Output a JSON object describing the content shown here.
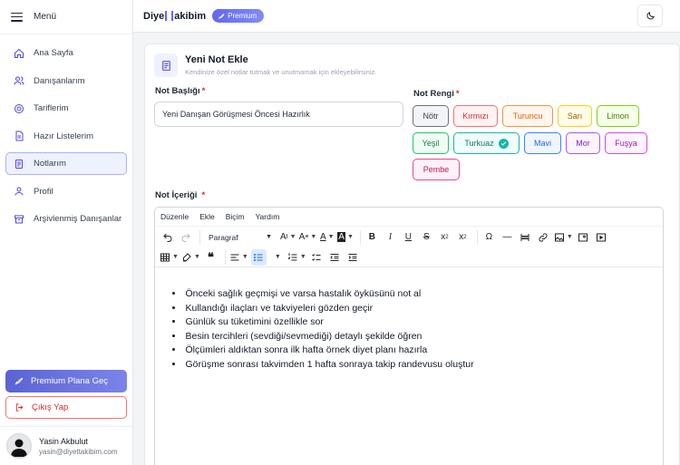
{
  "sidebar": {
    "title": "Menü",
    "items": [
      {
        "label": "Ana Sayfa",
        "icon": "home-icon"
      },
      {
        "label": "Danışanlarım",
        "icon": "users-icon"
      },
      {
        "label": "Tariflerim",
        "icon": "recipe-icon"
      },
      {
        "label": "Hazır Listelerim",
        "icon": "list-icon"
      },
      {
        "label": "Notlarım",
        "icon": "notes-icon",
        "active": true
      },
      {
        "label": "Profil",
        "icon": "user-icon"
      },
      {
        "label": "Arşivlenmiş Danışanlar",
        "icon": "archive-icon"
      }
    ],
    "premium_label": "Premium Plana Geç",
    "logout_label": "Çıkış Yap",
    "user": {
      "name": "Yasin Akbulut",
      "email": "yasin@diyettakibim.com"
    }
  },
  "header": {
    "logo_left": "Diye",
    "logo_right": "akibim",
    "premium_badge": "Premium"
  },
  "form": {
    "title": "Yeni Not Ekle",
    "subtitle": "Kendinize özel notlar tutmak ve unutmamak için ekleyebilirsiniz.",
    "note_title_label": "Not Başlığı",
    "note_title_value": "Yeni Danışan Görüşmesi Öncesi Hazırlık",
    "color_label": "Not Rengi",
    "colors": [
      {
        "label": "Nötr",
        "border": "#6b7280",
        "bg": "#f3f4f6",
        "text": "#374151"
      },
      {
        "label": "Kırmızı",
        "border": "#f87171",
        "bg": "#fef2f2",
        "text": "#dc2626"
      },
      {
        "label": "Turuncu",
        "border": "#fb923c",
        "bg": "#fff7ed",
        "text": "#ea580c"
      },
      {
        "label": "Sarı",
        "border": "#facc15",
        "bg": "#fefce8",
        "text": "#a16207"
      },
      {
        "label": "Limon",
        "border": "#84cc16",
        "bg": "#f7fee7",
        "text": "#4d7c0f"
      },
      {
        "label": "Yeşil",
        "border": "#22c55e",
        "bg": "#f0fdf4",
        "text": "#15803d"
      },
      {
        "label": "Turkuaz",
        "border": "#14b8a6",
        "bg": "#f0fdfa",
        "text": "#0f766e",
        "selected": true
      },
      {
        "label": "Mavi",
        "border": "#3b82f6",
        "bg": "#eff6ff",
        "text": "#2563eb"
      },
      {
        "label": "Mor",
        "border": "#a855f7",
        "bg": "#faf5ff",
        "text": "#7e22ce"
      },
      {
        "label": "Fuşya",
        "border": "#d946ef",
        "bg": "#fdf4ff",
        "text": "#a21caf"
      },
      {
        "label": "Pembe",
        "border": "#ec4899",
        "bg": "#fdf2f8",
        "text": "#be185d"
      }
    ],
    "content_label": "Not İçeriği",
    "editor": {
      "menus": [
        "Düzenle",
        "Ekle",
        "Biçim",
        "Yardım"
      ],
      "format_value": "Paragraf",
      "bullets": [
        "Önceki sağlık geçmişi ve varsa hastalık öyküsünü not al",
        "Kullandığı ilaçları ve takviyeleri gözden geçir",
        "Günlük su tüketimini özellikle sor",
        "Besin tercihleri (sevdiği/sevmediği) detaylı şekilde öğren",
        "Ölçümleri aldıktan sonra ilk hafta örnek diyet planı hazırla",
        "Görüşme sonrası takvimden 1 hafta sonraya takip randevusu oluştur"
      ]
    }
  },
  "colors": {
    "accent": "#6366f1",
    "danger": "#dc2626"
  }
}
